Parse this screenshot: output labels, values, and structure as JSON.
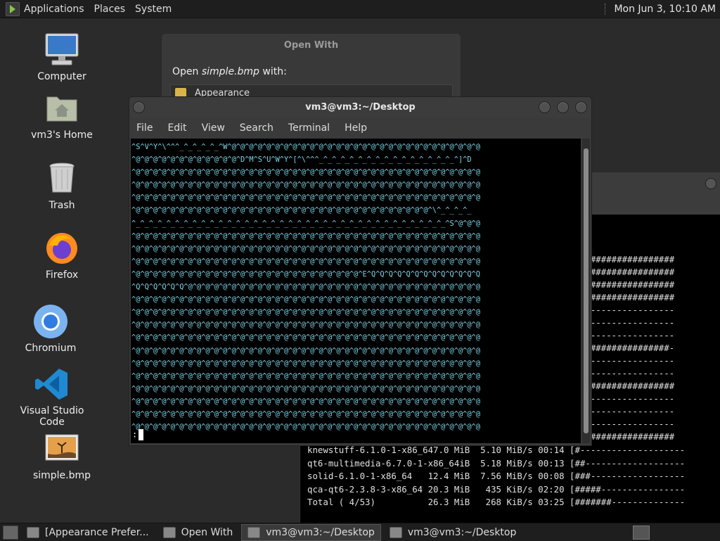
{
  "top_panel": {
    "menus": [
      "Applications",
      "Places",
      "System"
    ],
    "clock": "Mon Jun  3, 10:10 AM"
  },
  "desktop_icons": [
    {
      "label": "Computer",
      "icon": "computer-icon"
    },
    {
      "label": "vm3's Home",
      "icon": "home-folder-icon"
    },
    {
      "label": "Trash",
      "icon": "trash-icon"
    },
    {
      "label": "Firefox",
      "icon": "firefox-icon"
    },
    {
      "label": "Chromium",
      "icon": "chromium-icon"
    },
    {
      "label": "Visual Studio Code",
      "icon": "vscode-icon"
    },
    {
      "label": "simple.bmp",
      "icon": "image-file-icon"
    }
  ],
  "open_with_dialog": {
    "title": "Open With",
    "prompt_prefix": "Open ",
    "prompt_file": "simple.bmp",
    "prompt_suffix": " with:",
    "first_item": "Appearance"
  },
  "terminal": {
    "title": "vm3@vm3:~/Desktop",
    "menu": [
      "File",
      "Edit",
      "View",
      "Search",
      "Terminal",
      "Help"
    ],
    "lines": [
      "^S^V^Y^\\^^^_^_^_^_^_^W^@^@^@^@^@^@^@^@^@^@^@^@^@^@^@^@^@^@^@^@^@^@^@^@^@^@^@^@^@",
      "^@^@^@^@^@^@^@^@^@^@^@^@^D^M^S^U^W^Y^[^\\^^^_^_^_^_^_^_^_^_^_^_^_^_^_^_^_^_^]^D",
      "^@^@^@^@^@^@^@^@^@^@^@^@^@^@^@^@^@^@^@^@^@^@^@^@^@^@^@^@^@^@^@^@^@^@^@^@^@^@^@^@",
      "^@^@^@^@^@^@^@^@^@^@^@^@^@^@^@^@^@^@^@^@^@^@^@^@^@^@^@^@^@^@^@^@^@^@^@^@^@^@^@^@",
      "^@^@^@^@^@^@^@^@^@^@^@^@^@^@^@^@^@^@^@^@^@^@^@^@^@^@^@^@^@^@^@^@^@^@^@^@^@^@^@^@",
      "^@^@^@^@^@^@^@^@^@^@^@^@^@^@^@^@^@^@^@^@^@^@^@^@^@^@^@^@^@^@^@^@^@^@^\\^_^_^_^_",
      "^_^_^_^_^_^_^_^_^_^_^_^_^_^_^_^_^_^_^_^_^_^_^_^_^_^_^_^_^_^_^_^_^_^_^_^_^S^@^@^@",
      "^@^@^@^@^@^@^@^@^@^@^@^@^@^@^@^@^@^@^@^@^@^@^@^@^@^@^@^@^@^@^@^@^@^@^@^@^@^@^@^@",
      "^@^@^@^@^@^@^@^@^@^@^@^@^@^@^@^@^@^@^@^@^@^@^@^@^@^@^@^@^@^@^@^@^@^@^@^@^@^@^@^@",
      "^@^@^@^@^@^@^@^@^@^@^@^@^@^@^@^@^@^@^@^@^@^@^@^@^@^@^@^@^@^@^@^@^@^@^@^@^@^@^@^@",
      "^@^@^@^@^@^@^@^@^@^@^@^@^@^@^@^@^@^@^@^@^@^@^@^@^@^@^E^Q^Q^Q^Q^Q^Q^Q^Q^Q^Q^Q^Q^Q",
      "^Q^Q^Q^Q^Q^Q^@^@^@^@^@^@^@^@^@^@^@^@^@^@^@^@^@^@^@^@^@^@^@^@^@^@^@^@^@^@^@^@^@^@",
      "^@^@^@^@^@^@^@^@^@^@^@^@^@^@^@^@^@^@^@^@^@^@^@^@^@^@^@^@^@^@^@^@^@^@^@^@^@^@^@^@",
      "^@^@^@^@^@^@^@^@^@^@^@^@^@^@^@^@^@^@^@^@^@^@^@^@^@^@^@^@^@^@^@^@^@^@^@^@^@^@^@^@",
      "^@^@^@^@^@^@^@^@^@^@^@^@^@^@^@^@^@^@^@^@^@^@^@^@^@^@^@^@^@^@^@^@^@^@^@^@^@^@^@^@",
      "^@^@^@^@^@^@^@^@^@^@^@^@^@^@^@^@^@^@^@^@^@^@^@^@^@^@^@^@^@^@^@^@^@^@^@^@^@^@^@^@",
      "^@^@^@^@^@^@^@^@^@^@^@^@^@^@^@^@^@^@^@^@^@^@^@^@^@^@^@^@^@^@^@^@^@^@^@^@^@^@^@^@",
      "^@^@^@^@^@^@^@^@^@^@^@^@^@^@^@^@^@^@^@^@^@^@^@^@^@^@^@^@^@^@^@^@^@^@^@^@^@^@^@^@",
      "^@^@^@^@^@^@^@^@^@^@^@^@^@^@^@^@^@^@^@^@^@^@^@^@^@^@^@^@^@^@^@^@^@^@^@^@^@^@^@^@",
      "^@^@^@^@^@^@^@^@^@^@^@^@^@^@^@^@^@^@^@^@^@^@^@^@^@^@^@^@^@^@^@^@^@^@^@^@^@^@^@^@",
      "^@^@^@^@^@^@^@^@^@^@^@^@^@^@^@^@^@^@^@^@^@^@^@^@^@^@^@^@^@^@^@^@^@^@^@^@^@^@^@^@",
      "^@^@^@^@^@^@^@^@^@^@^@^@^@^@^@^@^@^@^@^@^@^@^@^@^@^@^@^@^@^@^@^@^@^@^@^@^@^@^@^@",
      "^@^@^@^@^@^@^@^@^@^@^@^@^@^@^@^@^@^@^@^@^@^@^@^@^@^@^@^@^@^@^@^@^@^@^@^@^@^@^@^@"
    ],
    "prompt": ":"
  },
  "terminal2": {
    "progress_lines": [
      "#####################",
      "#####################",
      "#####################",
      "#####################",
      "---------------------",
      "---------------------",
      "---------------------",
      "####################-",
      "---------------------",
      "---------------------",
      "#####################",
      "---------------------",
      "---------------------",
      "---------------------",
      "#####################"
    ],
    "bottom_lines": [
      "knewstuff-6.1.0-1-x86_647.0 MiB  5.10 MiB/s 00:14 [#--------------------",
      "qt6-multimedia-6.7.0-1-x86_64iB  5.18 MiB/s 00:13 [##-------------------",
      "solid-6.1.0-1-x86_64   12.4 MiB  7.56 MiB/s 00:08 [###------------------",
      "qca-qt6-2.3.8-3-x86_64 20.3 MiB   435 KiB/s 02:20 [#####----------------",
      "Total ( 4/53)          26.3 MiB   268 KiB/s 03:25 [#######--------------"
    ]
  },
  "taskbar": {
    "tasks": [
      {
        "label": "[Appearance Prefer...",
        "active": false
      },
      {
        "label": "Open With",
        "active": false
      },
      {
        "label": "vm3@vm3:~/Desktop",
        "active": true
      },
      {
        "label": "vm3@vm3:~/Desktop",
        "active": false
      }
    ]
  }
}
